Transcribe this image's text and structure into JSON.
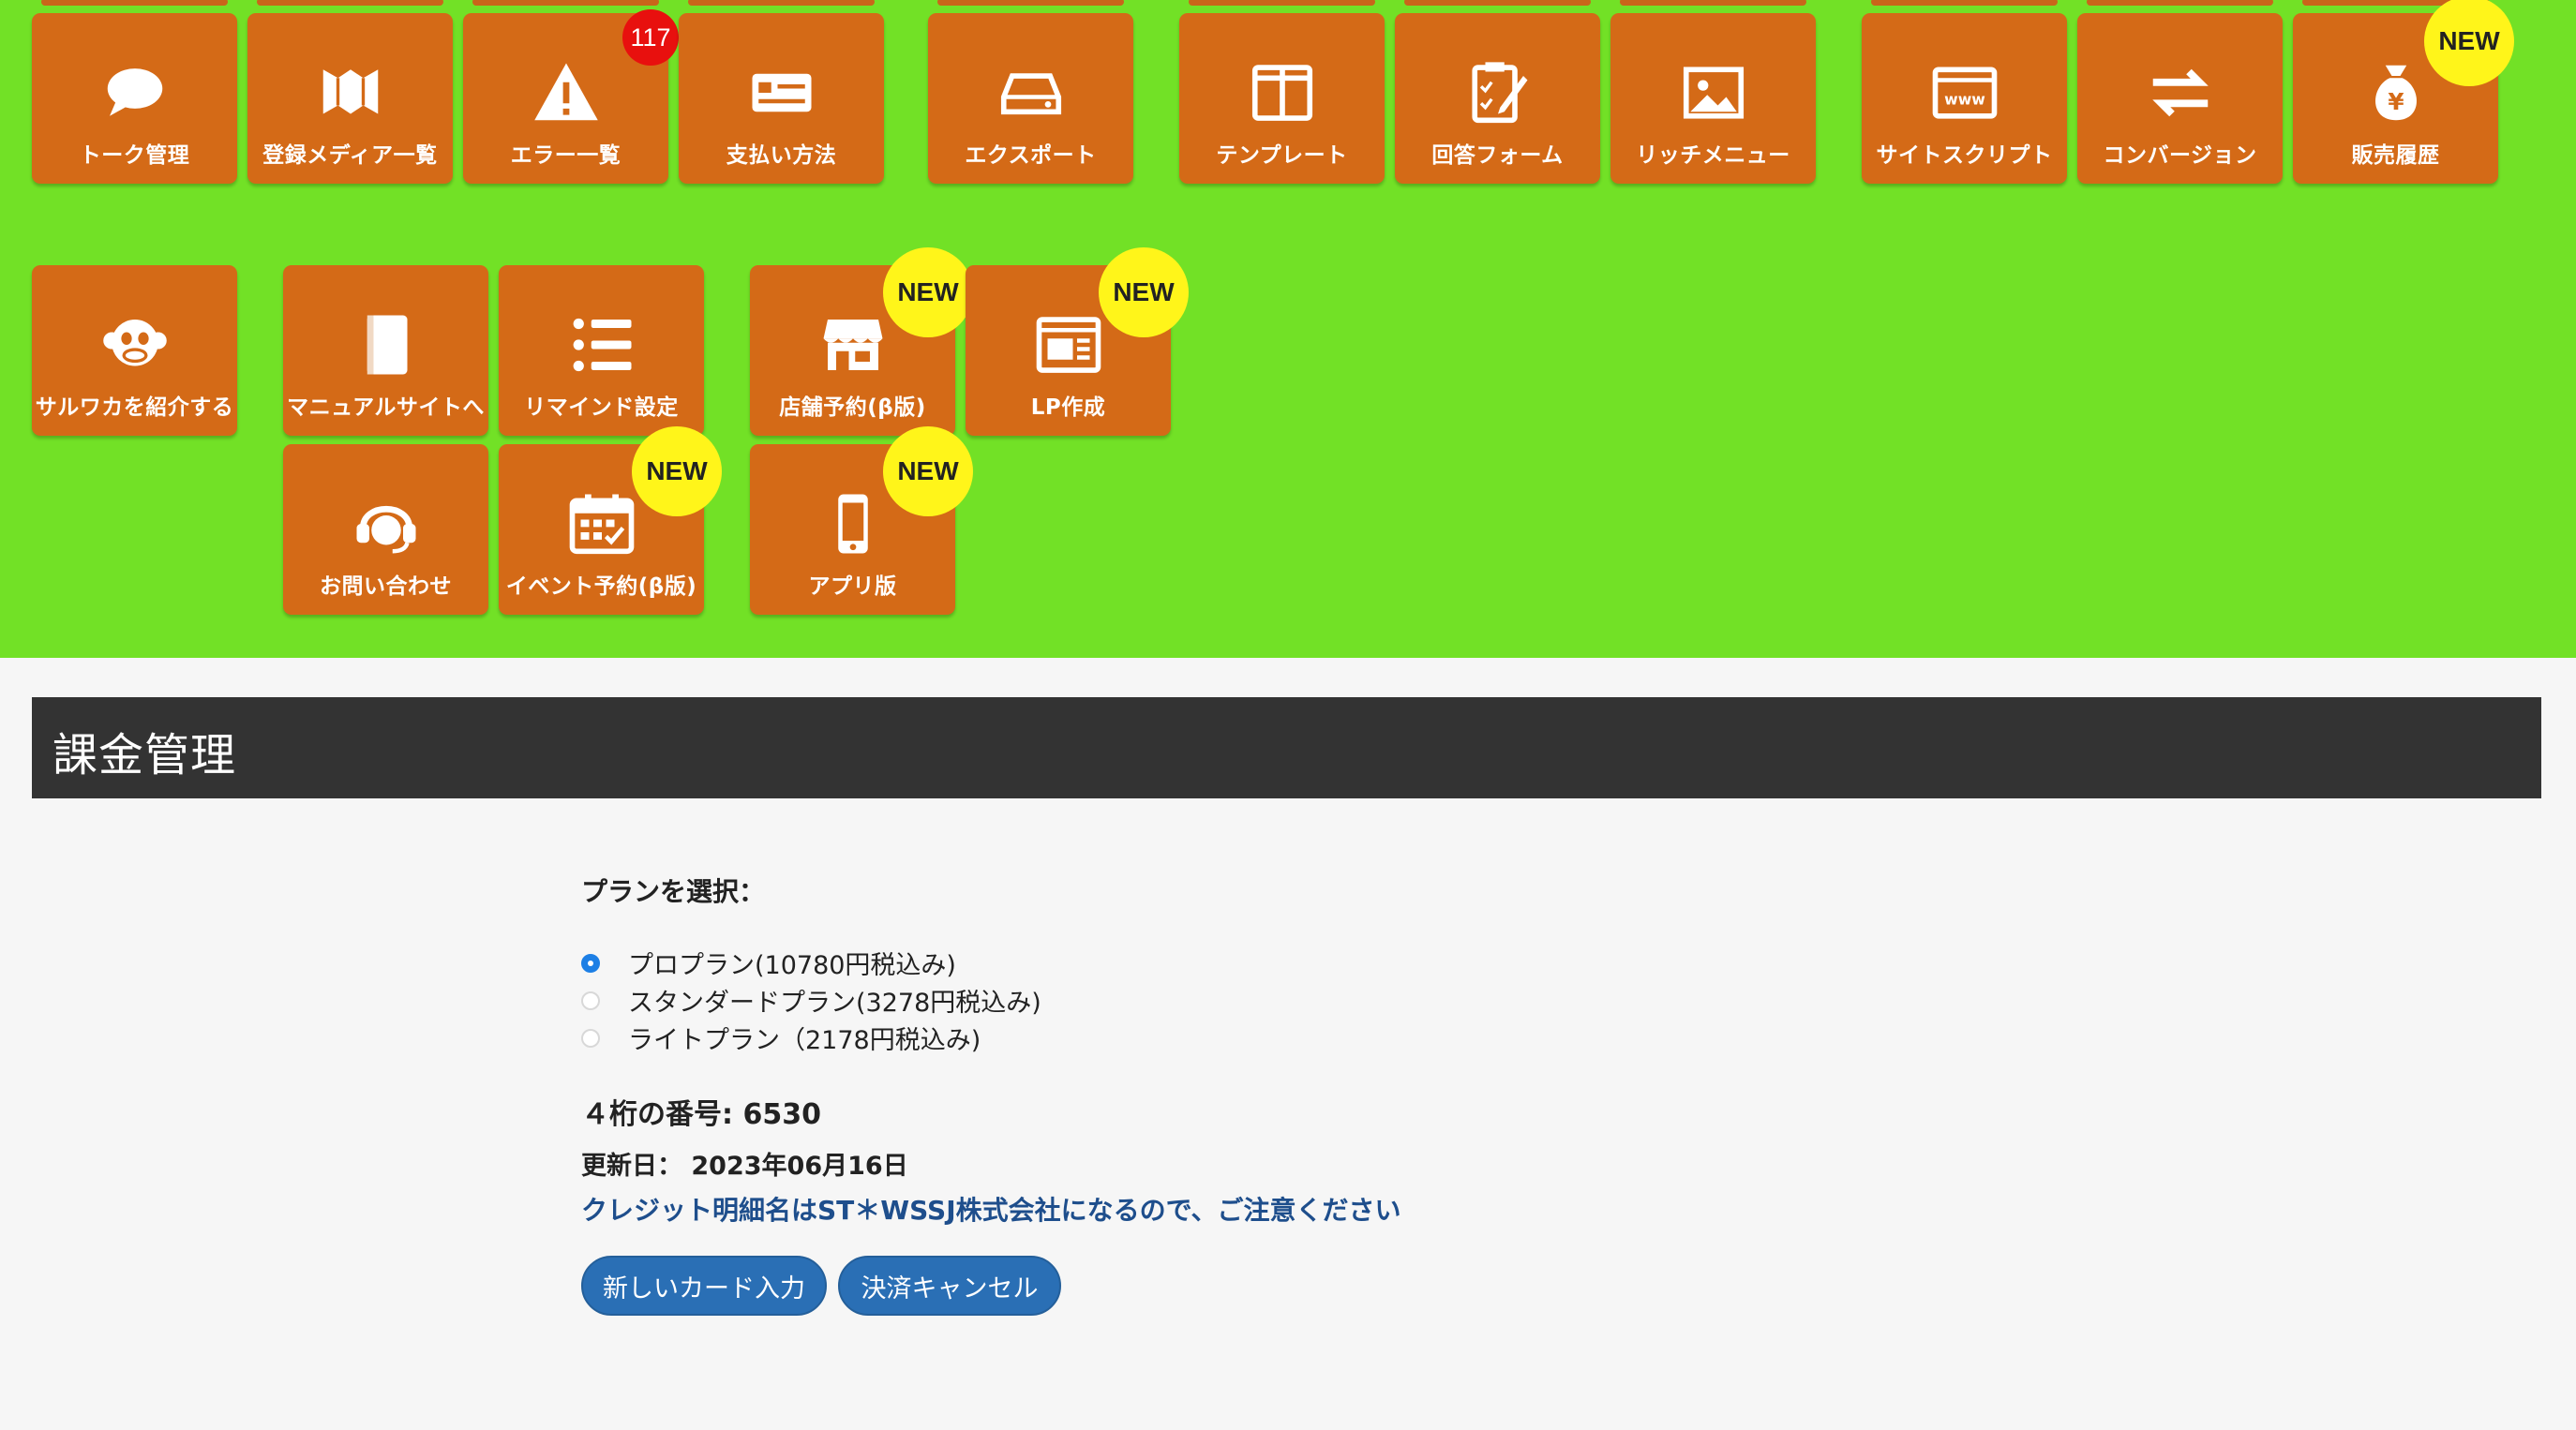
{
  "menu": {
    "row1": [
      {
        "label": "トーク管理",
        "icon": "speech-bubble-icon"
      },
      {
        "label": "登録メディア一覧",
        "icon": "media-icon"
      },
      {
        "label": "エラー一覧",
        "icon": "warning-icon",
        "count": "117"
      },
      {
        "label": "支払い方法",
        "icon": "credit-card-icon"
      },
      {
        "label": "エクスポート",
        "icon": "drive-icon"
      },
      {
        "label": "テンプレート",
        "icon": "template-icon"
      },
      {
        "label": "回答フォーム",
        "icon": "form-icon"
      },
      {
        "label": "リッチメニュー",
        "icon": "image-icon"
      },
      {
        "label": "サイトスクリプト",
        "icon": "www-icon"
      },
      {
        "label": "コンバージョン",
        "icon": "exchange-icon"
      },
      {
        "label": "販売履歴",
        "icon": "money-bag-icon"
      }
    ],
    "row2": [
      {
        "label": "サルワカを紹介する",
        "icon": "monkey-icon"
      },
      {
        "label": "マニュアルサイトへ",
        "icon": "book-icon"
      },
      {
        "label": "リマインド設定",
        "icon": "list-icon"
      },
      {
        "label": "店舗予約(β版)",
        "icon": "store-icon"
      },
      {
        "label": "LP作成",
        "icon": "webpage-icon"
      }
    ],
    "row3": [
      {
        "label": "お問い合わせ",
        "icon": "headset-icon"
      },
      {
        "label": "イベント予約(β版)",
        "icon": "calendar-icon"
      },
      {
        "label": "アプリ版",
        "icon": "smartphone-icon"
      }
    ],
    "new_label": "NEW"
  },
  "billing": {
    "title": "課金管理",
    "plan_label": "プランを選択：",
    "plans": [
      {
        "label": "プロプラン(10780円税込み)",
        "checked": true
      },
      {
        "label": "スタンダードプラン(3278円税込み)",
        "checked": false
      },
      {
        "label": "ライトプラン（2178円税込み)",
        "checked": false
      }
    ],
    "card_number": "４桁の番号: 6530",
    "update_date": "更新日： 2023年06月16日",
    "notice": "クレジット明細名はST＊WSSJ株式会社になるので、ご注意ください",
    "new_card_button": "新しいカード入力",
    "cancel_button": "決済キャンセル"
  },
  "colors": {
    "menu_background": "#72e126",
    "tile": "#d46a17",
    "new_badge": "#fff51a",
    "error_badge": "#e8100e",
    "header_bar": "#333333",
    "button": "#2a6fb5",
    "notice_text": "#1e4e8c"
  }
}
